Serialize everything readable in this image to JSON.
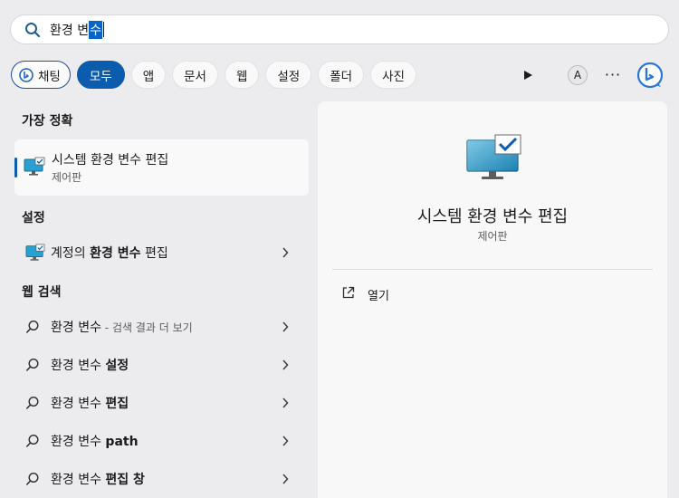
{
  "search": {
    "query_prefix": "환경 변",
    "query_selected": "수"
  },
  "filters": {
    "chat": "채팅",
    "tabs": [
      "모두",
      "앱",
      "문서",
      "웹",
      "설정",
      "폴더",
      "사진"
    ],
    "active": "모두",
    "avatar_letter": "A",
    "more": "···"
  },
  "best_match": {
    "heading": "가장 정확",
    "title": "시스템 환경 변수 편집",
    "subtitle": "제어판"
  },
  "settings": {
    "heading": "설정",
    "item_prefix": "계정의 ",
    "item_bold": "환경 변수",
    "item_suffix": " 편집"
  },
  "web": {
    "heading": "웹 검색",
    "items": [
      {
        "base": "환경 변수",
        "bold": "",
        "sub": " - 검색 결과 더 보기"
      },
      {
        "base": "환경 변수 ",
        "bold": "설정",
        "sub": ""
      },
      {
        "base": "환경 변수 ",
        "bold": "편집",
        "sub": ""
      },
      {
        "base": "환경 변수 ",
        "bold": "path",
        "sub": ""
      },
      {
        "base": "환경 변수 ",
        "bold": "편집 창",
        "sub": ""
      }
    ]
  },
  "detail": {
    "title": "시스템 환경 변수 편집",
    "subtitle": "제어판",
    "open_label": "열기"
  },
  "colors": {
    "accent": "#0b5cad",
    "selection": "#0a64c8"
  }
}
